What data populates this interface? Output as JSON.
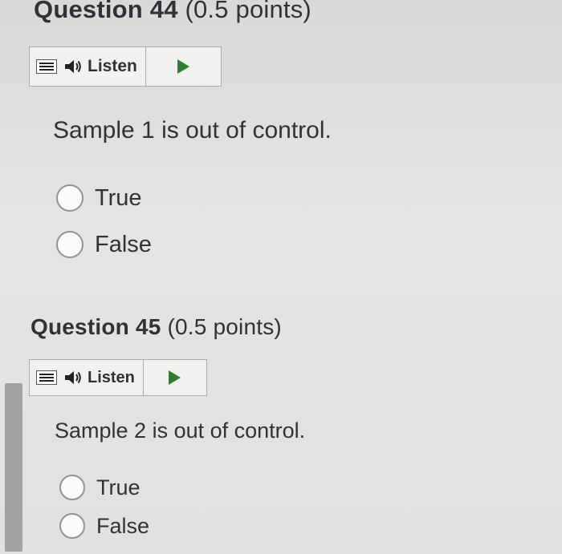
{
  "questions": [
    {
      "name": "Question 44",
      "points": "(0.5 points)",
      "listen_label": "Listen",
      "text": "Sample 1 is out of control.",
      "options": [
        "True",
        "False"
      ]
    },
    {
      "name": "Question 45",
      "points": "(0.5 points)",
      "listen_label": "Listen",
      "text": "Sample 2 is out of control.",
      "options": [
        "True",
        "False"
      ]
    }
  ],
  "icons": {
    "menu": "menu-icon",
    "speaker": "speaker-icon",
    "play": "play-icon"
  },
  "colors": {
    "play_accent": "#2e7d32",
    "text": "#2f3338",
    "border": "#a9adb1"
  }
}
